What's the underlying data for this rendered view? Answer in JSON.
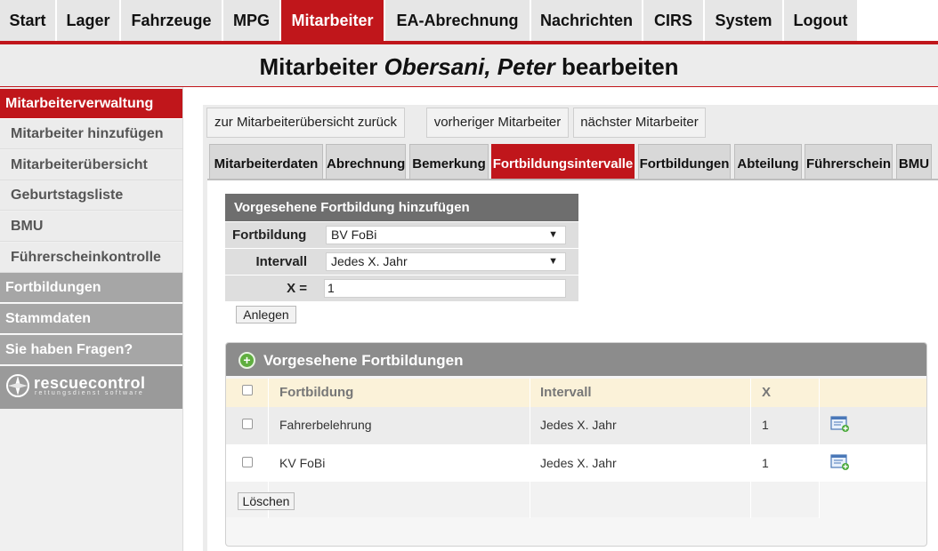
{
  "nav": {
    "items": [
      "Start",
      "Lager",
      "Fahrzeuge",
      "MPG",
      "Mitarbeiter",
      "EA-Abrechnung",
      "Nachrichten",
      "CIRS",
      "System",
      "Logout"
    ],
    "active": "Mitarbeiter"
  },
  "page": {
    "title_prefix": "Mitarbeiter",
    "title_name": "Obersani, Peter",
    "title_suffix": "bearbeiten"
  },
  "sidebar": {
    "head_active": "Mitarbeiterverwaltung",
    "subitems": [
      "Mitarbeiter hinzufügen",
      "Mitarbeiterübersicht",
      "Geburtstagsliste",
      "BMU",
      "Führerscheinkontrolle"
    ],
    "heads": [
      "Fortbildungen",
      "Stammdaten",
      "Sie haben Fragen?"
    ],
    "logo_text": "rescuecontrol",
    "logo_sub": "rettungsdienst software"
  },
  "toolbar": {
    "back": "zur Mitarbeiterübersicht zurück",
    "prev": "vorheriger Mitarbeiter",
    "next": "nächster Mitarbeiter"
  },
  "tabs": [
    "Mitarbeiterdaten",
    "Abrechnung",
    "Bemerkung",
    "Fortbildungsintervalle",
    "Fortbildungen",
    "Abteilung",
    "Führerschein",
    "BMU"
  ],
  "active_tab": "Fortbildungsintervalle",
  "form": {
    "title": "Vorgesehene Fortbildung hinzufügen",
    "fortbildung_label": "Fortbildung",
    "fortbildung_value": "BV FoBi",
    "intervall_label": "Intervall",
    "intervall_value": "Jedes X. Jahr",
    "x_label": "X =",
    "x_value": "1",
    "submit": "Anlegen"
  },
  "panel": {
    "title": "Vorgesehene Fortbildungen",
    "columns": [
      "Fortbildung",
      "Intervall",
      "X"
    ],
    "rows": [
      {
        "fortbildung": "Fahrerbelehrung",
        "intervall": "Jedes X. Jahr",
        "x": "1"
      },
      {
        "fortbildung": "KV FoBi",
        "intervall": "Jedes X. Jahr",
        "x": "1"
      }
    ],
    "delete": "Löschen"
  },
  "colors": {
    "accent": "#c0161b",
    "sidebar_head": "#a6a6a6",
    "table_header": "#fbf2d9"
  }
}
